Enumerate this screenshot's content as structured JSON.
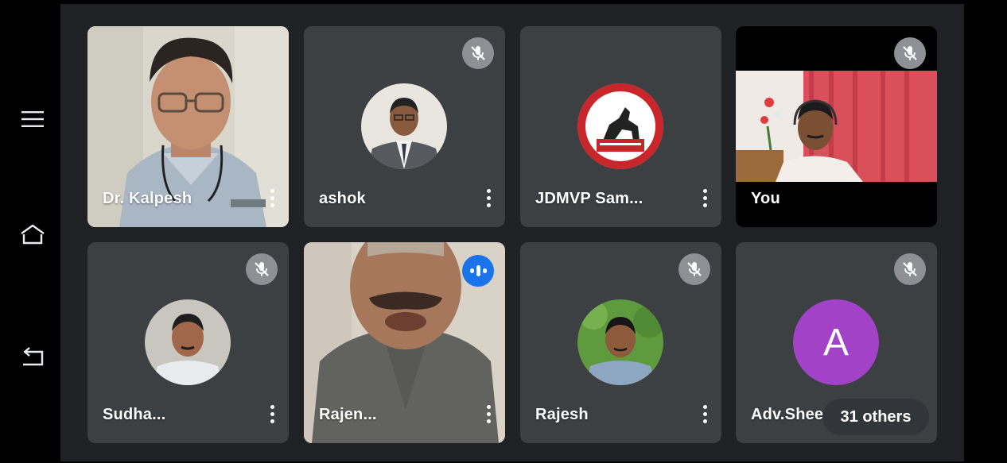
{
  "nav": {
    "items": [
      {
        "icon": "menu-icon"
      },
      {
        "icon": "home-icon"
      },
      {
        "icon": "back-icon"
      }
    ]
  },
  "participants": [
    {
      "name": "Dr. Kalpesh",
      "video": true,
      "muted": false
    },
    {
      "name": "ashok",
      "video": false,
      "muted": true
    },
    {
      "name": "JDMVP Sam...",
      "video": false,
      "muted": false
    },
    {
      "name": "You",
      "video": true,
      "muted": true
    },
    {
      "name": "Sudha...",
      "video": false,
      "muted": true
    },
    {
      "name": "Rajen...",
      "video": true,
      "muted": false,
      "speaking": true
    },
    {
      "name": "Rajesh",
      "video": false,
      "muted": true
    },
    {
      "name": "Adv.Shee",
      "video": false,
      "muted": true,
      "initial": "A"
    }
  ],
  "others": {
    "label": "31 others"
  },
  "colors": {
    "stage_bg": "#202124",
    "tile_bg": "#3c4043",
    "speaking_blue": "#1a73e8",
    "avatar_purple": "#a142c7",
    "mute_grey": "#8e9095"
  }
}
